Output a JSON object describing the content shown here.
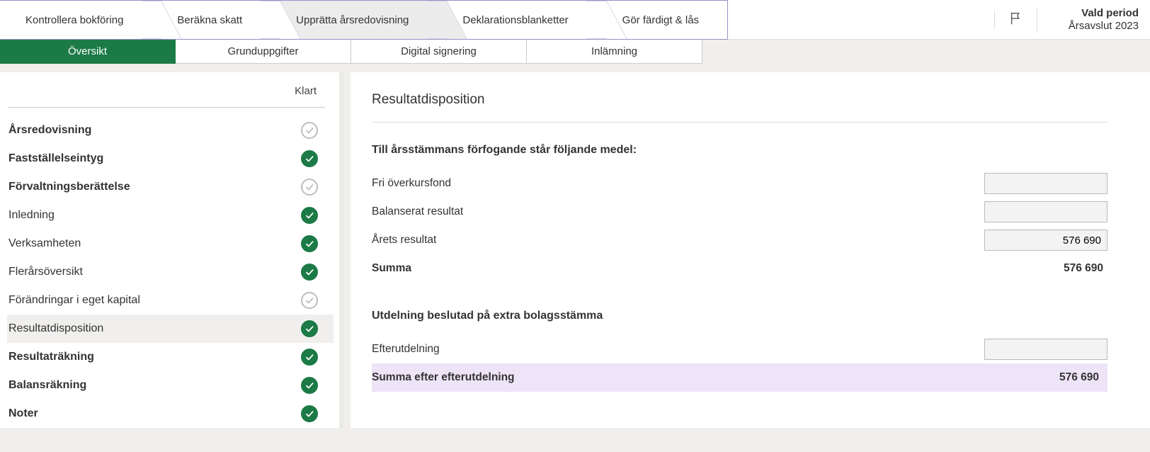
{
  "wizard": {
    "steps": [
      "Kontrollera bokföring",
      "Beräkna skatt",
      "Upprätta årsredovisning",
      "Deklarationsblanketter",
      "Gör färdigt & lås"
    ]
  },
  "period": {
    "label": "Vald period",
    "value": "Årsavslut 2023"
  },
  "sub_tabs": [
    "Översikt",
    "Grunduppgifter",
    "Digital signering",
    "Inlämning"
  ],
  "sidebar": {
    "klart_label": "Klart",
    "items": [
      {
        "label": "Årsredovisning",
        "bold": true,
        "status": "open"
      },
      {
        "label": "Fastställelseintyg",
        "bold": true,
        "status": "done"
      },
      {
        "label": "Förvaltningsberättelse",
        "bold": true,
        "status": "open"
      },
      {
        "label": "Inledning",
        "bold": false,
        "status": "done"
      },
      {
        "label": "Verksamheten",
        "bold": false,
        "status": "done"
      },
      {
        "label": "Flerårsöversikt",
        "bold": false,
        "status": "done"
      },
      {
        "label": "Förändringar i eget kapital",
        "bold": false,
        "status": "open"
      },
      {
        "label": "Resultatdisposition",
        "bold": false,
        "status": "done",
        "selected": true
      },
      {
        "label": "Resultaträkning",
        "bold": true,
        "status": "done"
      },
      {
        "label": "Balansräkning",
        "bold": true,
        "status": "done"
      },
      {
        "label": "Noter",
        "bold": true,
        "status": "done"
      }
    ]
  },
  "content": {
    "title": "Resultatdisposition",
    "section1_title": "Till årsstämmans förfogande står följande medel:",
    "rows1": {
      "fri_overkursfond": {
        "label": "Fri överkursfond",
        "value": ""
      },
      "balanserat_resultat": {
        "label": "Balanserat resultat",
        "value": ""
      },
      "arets_resultat": {
        "label": "Årets resultat",
        "value": "576 690"
      },
      "summa": {
        "label": "Summa",
        "value": "576 690"
      }
    },
    "section2_title": "Utdelning beslutad på extra bolagsstämma",
    "rows2": {
      "efterutdelning": {
        "label": "Efterutdelning",
        "value": ""
      },
      "summa_efter": {
        "label": "Summa efter efterutdelning",
        "value": "576 690"
      }
    }
  }
}
